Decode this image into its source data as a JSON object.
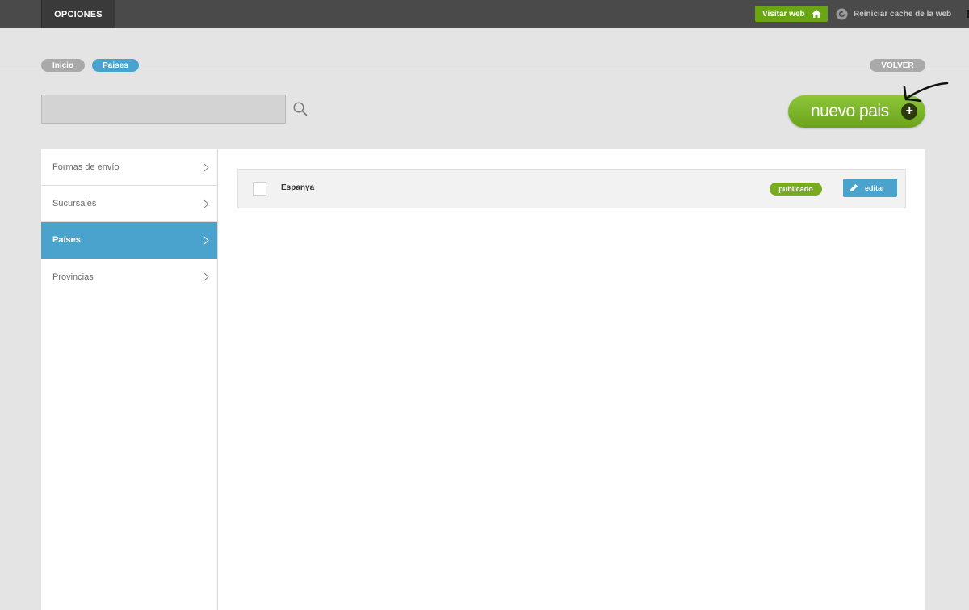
{
  "topbar": {
    "options_label": "OPCIONES",
    "visit_label": "Visitar web",
    "reset_cache_label": "Reiniciar cache de la web"
  },
  "breadcrumb": {
    "items": [
      "Inicio",
      "Paises"
    ]
  },
  "back_label": "VOLVER",
  "search": {
    "value": "",
    "placeholder": ""
  },
  "new_button": {
    "label": "nuevo pais"
  },
  "sidebar": {
    "items": [
      {
        "label": "Formas de envío",
        "active": false
      },
      {
        "label": "Sucursales",
        "active": false
      },
      {
        "label": "Países",
        "active": true
      },
      {
        "label": "Provincias",
        "active": false
      }
    ]
  },
  "table": {
    "rows": [
      {
        "name": "Espanya",
        "status": "publicado",
        "action": "editar"
      }
    ]
  },
  "colors": {
    "accent_blue": "#4aa3cd",
    "accent_green": "#6aa514",
    "topbar": "#4a4a4a"
  },
  "icons": [
    "home-icon",
    "refresh-icon",
    "search-icon",
    "plus-icon",
    "chevron-right-icon",
    "pencil-icon"
  ]
}
